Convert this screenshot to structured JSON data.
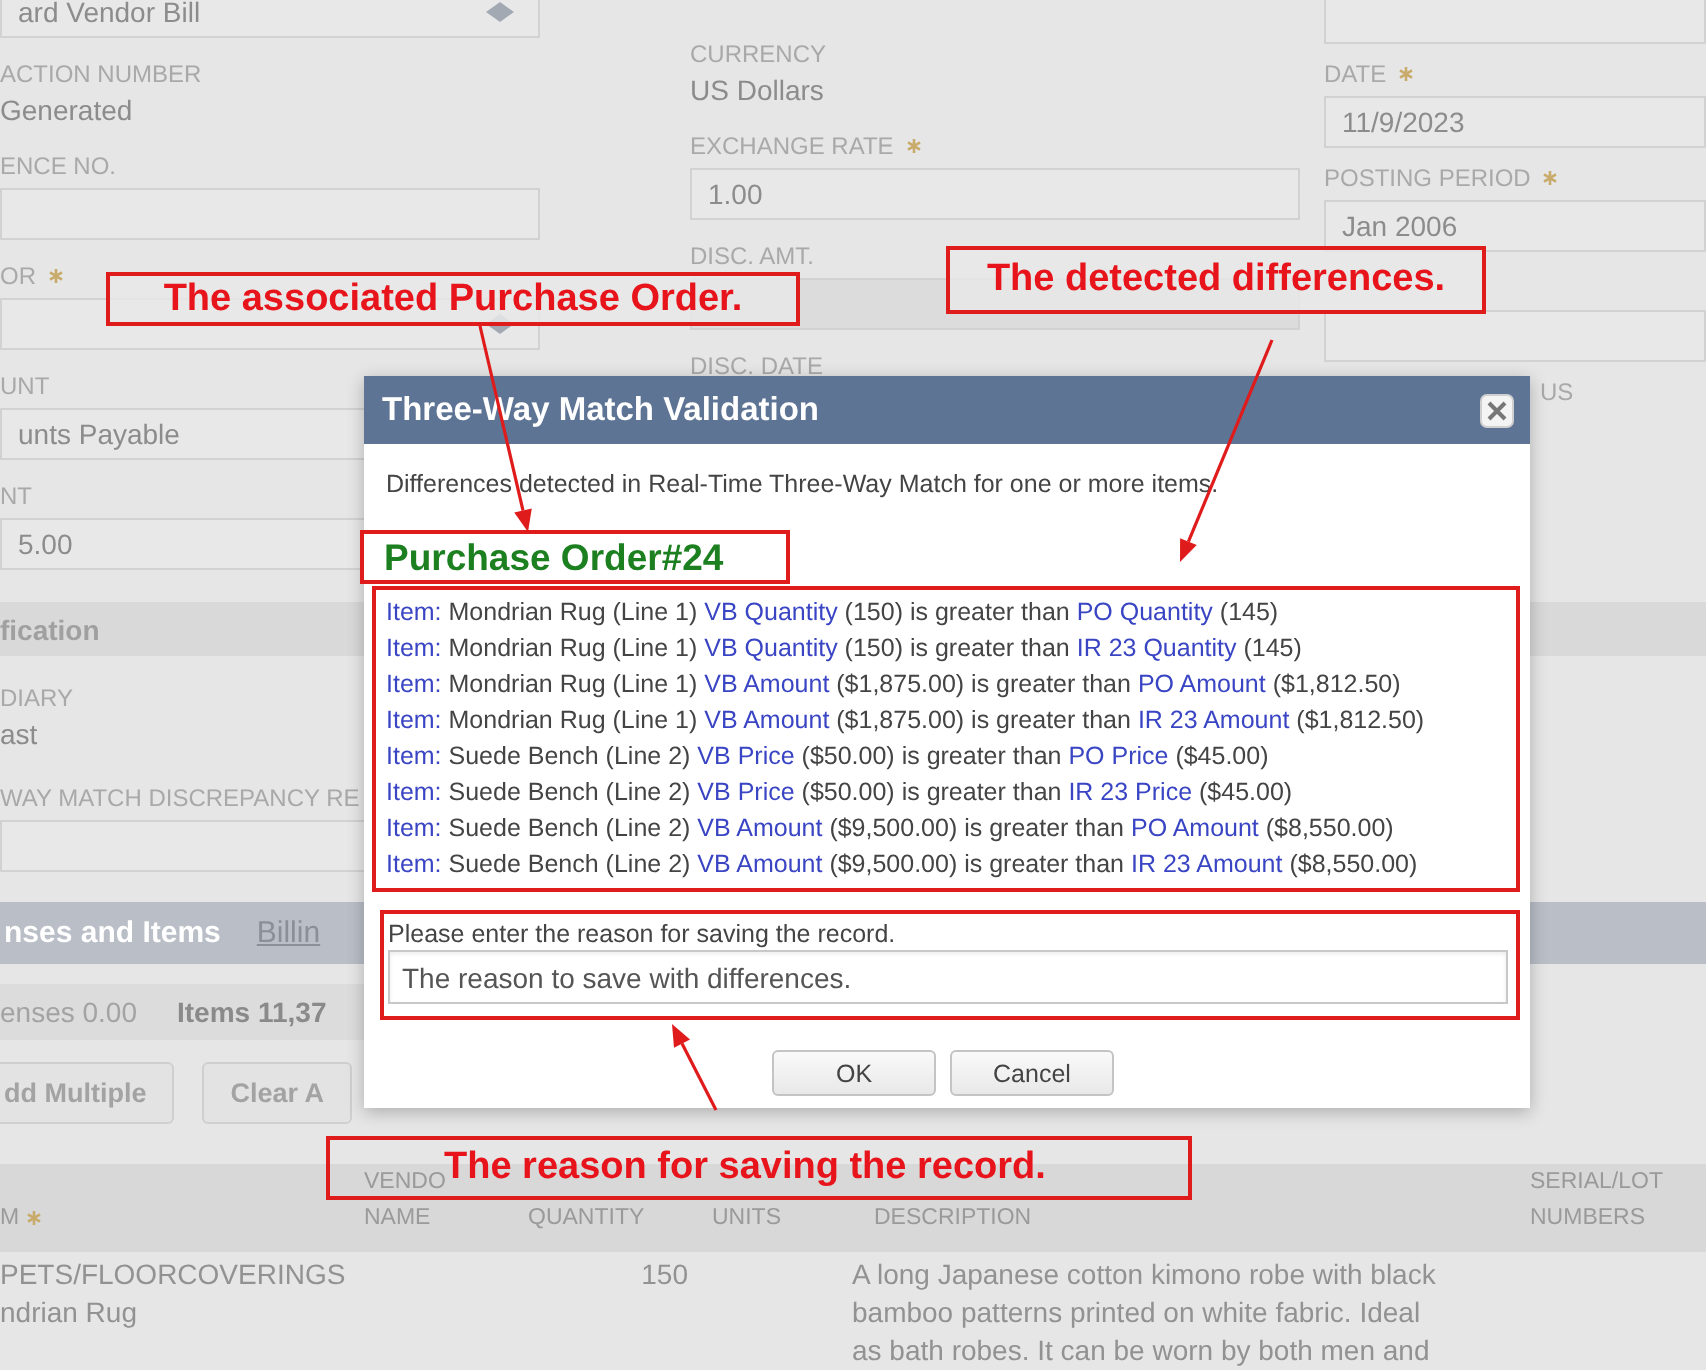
{
  "form_columns": [
    [
      {
        "kind": "select",
        "required": false,
        "value": "ard Vendor Bill"
      },
      {
        "kind": "text",
        "label": "ACTION NUMBER",
        "required": false,
        "value": "Generated"
      },
      {
        "kind": "input",
        "label": "ENCE NO.",
        "required": false
      },
      {
        "kind": "select",
        "label": "OR",
        "required": true
      },
      {
        "kind": "input",
        "label": "UNT",
        "required": false,
        "value": "unts Payable"
      },
      {
        "kind": "input",
        "label": "NT",
        "required": false,
        "value": "5.00"
      }
    ],
    [
      {
        "kind": "text",
        "label": "CURRENCY",
        "required": false,
        "value": "US Dollars"
      },
      {
        "kind": "input",
        "label": "EXCHANGE RATE",
        "required": true,
        "value": "1.00"
      },
      {
        "kind": "readonly",
        "label": "DISC. AMT.",
        "required": false
      },
      {
        "kind": "text",
        "label": "DISC. DATE",
        "required": false
      }
    ],
    [
      {
        "kind": "input",
        "required": false
      },
      {
        "kind": "input",
        "label": "DATE",
        "required": true,
        "value": "11/9/2023"
      },
      {
        "kind": "input",
        "label": "POSTING PERIOD",
        "required": true,
        "value": "Jan 2006"
      },
      {
        "kind": "input",
        "required": false
      },
      {
        "kind": "covered_label",
        "label": "US",
        "required": false
      }
    ]
  ],
  "classification": {
    "title": "fication",
    "fields": [
      {
        "kind": "text",
        "label": "DIARY",
        "required": false,
        "value": "ast"
      },
      {
        "kind": "input",
        "label": "WAY MATCH DISCREPANCY RE",
        "required": false
      }
    ]
  },
  "tabs": [
    {
      "label": "nses and Items",
      "selected": true
    },
    {
      "label": "Billin",
      "selected": false
    }
  ],
  "totals": [
    {
      "label": "enses 0.00",
      "selected": false
    },
    {
      "label": "Items 11,37",
      "selected": true
    }
  ],
  "buttons": [
    "dd Multiple",
    "Clear A"
  ],
  "table": {
    "columns": [
      {
        "lines": [
          "M"
        ],
        "required": true
      },
      {
        "lines": [
          "VENDO",
          "NAME"
        ],
        "required": false
      },
      {
        "lines": [
          "QUANTITY"
        ],
        "required": false
      },
      {
        "lines": [
          "UNITS"
        ],
        "required": false
      },
      {
        "lines": [
          "DESCRIPTION"
        ],
        "required": false
      },
      {
        "lines": [
          "SERIAL/LOT",
          "NUMBERS"
        ],
        "required": false
      }
    ],
    "rows": [
      {
        "item": [
          "PETS/FLOORCOVERINGS",
          "ndrian Rug"
        ],
        "quantity": "150",
        "description": [
          "A long Japanese cotton kimono robe with black",
          "bamboo patterns printed on white fabric. Ideal",
          "as bath robes. It can be worn by both men and"
        ]
      }
    ]
  },
  "dialog": {
    "title": "Three-Way Match Validation",
    "message": "Differences detected in Real-Time Three-Way Match for one or more items.",
    "order": "Purchase Order#24",
    "lines": [
      [
        {
          "kind": "link",
          "text": "Item:"
        },
        {
          "kind": "plain",
          "text": " Mondrian Rug (Line 1) "
        },
        {
          "kind": "link",
          "text": "VB Quantity"
        },
        {
          "kind": "plain",
          "text": " (150) is greater than "
        },
        {
          "kind": "link",
          "text": "PO Quantity"
        },
        {
          "kind": "plain",
          "text": " (145)"
        }
      ],
      [
        {
          "kind": "link",
          "text": "Item:"
        },
        {
          "kind": "plain",
          "text": " Mondrian Rug (Line 1) "
        },
        {
          "kind": "link",
          "text": "VB Quantity"
        },
        {
          "kind": "plain",
          "text": " (150) is greater than "
        },
        {
          "kind": "link",
          "text": "IR 23 Quantity"
        },
        {
          "kind": "plain",
          "text": " (145)"
        }
      ],
      [
        {
          "kind": "link",
          "text": "Item:"
        },
        {
          "kind": "plain",
          "text": " Mondrian Rug (Line 1) "
        },
        {
          "kind": "link",
          "text": "VB Amount"
        },
        {
          "kind": "plain",
          "text": " ($1,875.00) is greater than "
        },
        {
          "kind": "link",
          "text": "PO Amount"
        },
        {
          "kind": "plain",
          "text": " ($1,812.50)"
        }
      ],
      [
        {
          "kind": "link",
          "text": "Item:"
        },
        {
          "kind": "plain",
          "text": " Mondrian Rug (Line 1) "
        },
        {
          "kind": "link",
          "text": "VB Amount"
        },
        {
          "kind": "plain",
          "text": " ($1,875.00) is greater than "
        },
        {
          "kind": "link",
          "text": "IR 23 Amount"
        },
        {
          "kind": "plain",
          "text": " ($1,812.50)"
        }
      ],
      [
        {
          "kind": "link",
          "text": "Item:"
        },
        {
          "kind": "plain",
          "text": " Suede Bench (Line 2) "
        },
        {
          "kind": "link",
          "text": "VB Price"
        },
        {
          "kind": "plain",
          "text": " ($50.00) is greater than "
        },
        {
          "kind": "link",
          "text": "PO Price"
        },
        {
          "kind": "plain",
          "text": " ($45.00)"
        }
      ],
      [
        {
          "kind": "link",
          "text": "Item:"
        },
        {
          "kind": "plain",
          "text": " Suede Bench (Line 2) "
        },
        {
          "kind": "link",
          "text": "VB Price"
        },
        {
          "kind": "plain",
          "text": " ($50.00) is greater than "
        },
        {
          "kind": "link",
          "text": "IR 23 Price"
        },
        {
          "kind": "plain",
          "text": " ($45.00)"
        }
      ],
      [
        {
          "kind": "link",
          "text": "Item:"
        },
        {
          "kind": "plain",
          "text": " Suede Bench (Line 2) "
        },
        {
          "kind": "link",
          "text": "VB Amount"
        },
        {
          "kind": "plain",
          "text": " ($9,500.00) is greater than "
        },
        {
          "kind": "link",
          "text": "PO Amount"
        },
        {
          "kind": "plain",
          "text": " ($8,550.00)"
        }
      ],
      [
        {
          "kind": "link",
          "text": "Item:"
        },
        {
          "kind": "plain",
          "text": " Suede Bench (Line 2) "
        },
        {
          "kind": "link",
          "text": "VB Amount"
        },
        {
          "kind": "plain",
          "text": " ($9,500.00) is greater than "
        },
        {
          "kind": "link",
          "text": "IR 23 Amount"
        },
        {
          "kind": "plain",
          "text": " ($8,550.00)"
        }
      ]
    ],
    "reason_label": "Please enter the reason for saving the record.",
    "reason_value": "The reason to save with differences.",
    "buttons": [
      "OK",
      "Cancel"
    ]
  },
  "annotations": [
    {
      "text": "The associated Purchase Order."
    },
    {
      "text": "The detected differences."
    },
    {
      "text": "The reason for saving the record."
    }
  ]
}
